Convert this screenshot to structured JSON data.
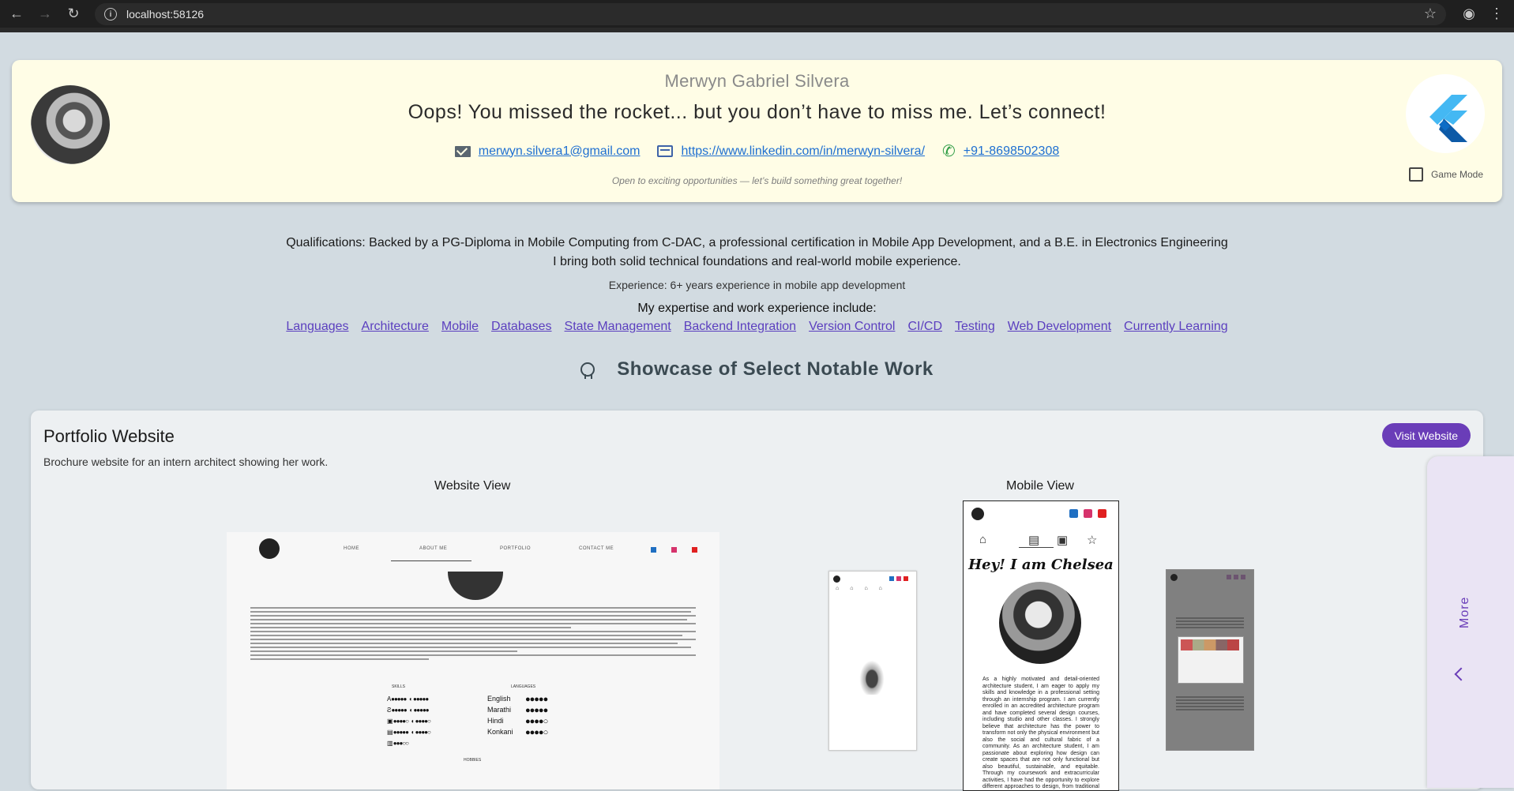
{
  "browser": {
    "url": "localhost:58126",
    "back_icon": "arrow-left-icon",
    "forward_icon": "arrow-right-icon",
    "reload_icon": "reload-icon"
  },
  "header": {
    "name": "Merwyn Gabriel Silvera",
    "tagline": "Oops! You missed the rocket... but you don’t have to miss me. Let’s connect!",
    "email": "merwyn.silvera1@gmail.com",
    "linkedin": "https://www.linkedin.com/in/merwyn-silvera/",
    "phone": "+91-8698502308",
    "note": "Open to exciting opportunities — let’s build something great together!",
    "game_mode_label": "Game Mode",
    "game_mode_checked": false
  },
  "summary": {
    "qualifications_line1": "Qualifications: Backed by a PG-Diploma in Mobile Computing from C-DAC, a professional certification in Mobile App Development, and a B.E. in Electronics Engineering",
    "qualifications_line2": "I bring both solid technical foundations and real-world mobile experience.",
    "experience": "Experience: 6+ years experience in mobile app development",
    "expertise_heading": "My expertise and work experience include:",
    "skills": [
      "Languages",
      "Architecture",
      "Mobile",
      "Databases",
      "State Management",
      "Backend Integration",
      "Version Control",
      "CI/CD",
      "Testing",
      "Web Development",
      "Currently Learning"
    ]
  },
  "showcase": {
    "heading": "Showcase of Select Notable Work"
  },
  "project": {
    "title": "Portfolio Website",
    "description": "Brochure website for an intern architect showing her work.",
    "visit_label": "Visit Website",
    "website_view_label": "Website View",
    "mobile_view_label": "Mobile View",
    "website_preview": {
      "nav": [
        "HOME",
        "ABOUT ME",
        "PORTFOLIO",
        "CONTACT ME"
      ],
      "skills_heading": "SKILLS",
      "languages_heading": "LANGUAGES",
      "hobbies_heading": "HOBBIES",
      "languages": [
        "English",
        "Marathi",
        "Hindi",
        "Konkani"
      ]
    },
    "mobile_preview": {
      "greeting": "Hey! I am Chelsea",
      "bio": "As a highly motivated and detail-oriented architecture student, I am eager to apply my skills and knowledge in a professional setting through an internship program. I am currently enrolled in an accredited architecture program and have completed several design courses, including studio and other classes. I strongly believe that architecture has the power to transform not only the physical environment but also the social and cultural fabric of a community. As an architecture student, I am passionate about exploring how design can create spaces that are not only functional but also beautiful, sustainable, and equitable. Through my coursework and extracurricular activities, I have had the opportunity to explore different approaches to design, from traditional to"
    }
  },
  "drawer": {
    "label": "More"
  }
}
